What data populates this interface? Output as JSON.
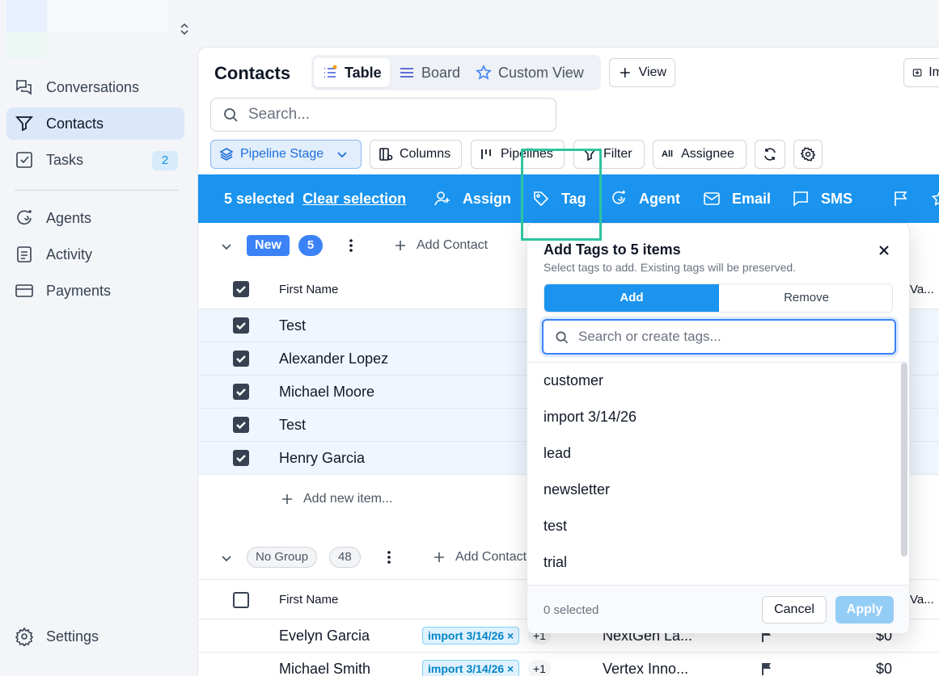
{
  "sidebar": {
    "items": [
      {
        "label": "Conversations",
        "icon": "chat-bubbles-icon"
      },
      {
        "label": "Contacts",
        "icon": "filter-funnel-icon"
      },
      {
        "label": "Tasks",
        "icon": "checkbox-icon",
        "badge": "2"
      },
      {
        "label": "Agents",
        "icon": "sparkle-agent-icon"
      },
      {
        "label": "Activity",
        "icon": "document-list-icon"
      },
      {
        "label": "Payments",
        "icon": "credit-card-icon"
      }
    ],
    "settings_label": "Settings"
  },
  "header": {
    "title": "Contacts",
    "tabs": [
      {
        "label": "Table",
        "active": true
      },
      {
        "label": "Board",
        "active": false
      },
      {
        "label": "Custom View",
        "active": false
      }
    ],
    "add_view_label": "View",
    "import_label": "Im"
  },
  "search": {
    "placeholder": "Search..."
  },
  "toolbar": {
    "pipeline_stage": "Pipeline Stage",
    "columns": "Columns",
    "pipelines": "Pipelines",
    "filter": "Filter",
    "assignee_prefix": "All",
    "assignee": "Assignee"
  },
  "selection_bar": {
    "count_text": "5 selected",
    "clear_label": "Clear selection",
    "actions": [
      "Assign",
      "Tag",
      "Agent",
      "Email",
      "SMS"
    ]
  },
  "groups": [
    {
      "name": "New",
      "count": "5",
      "add_contact_label": "Add Contact",
      "header_col": "First Name",
      "rows": [
        "Test",
        "Alexander Lopez",
        "Michael Moore",
        "Test",
        "Henry Garcia"
      ],
      "add_item_label": "Add new item..."
    },
    {
      "name": "No Group",
      "count": "48",
      "add_contact_label": "Add Contact",
      "header_col": "First Name",
      "rows": [
        {
          "name": "Evelyn Garcia",
          "tag": "import 3/14/26",
          "more": "+1",
          "company": "NextGen La...",
          "value": "$0"
        },
        {
          "name": "Michael Smith",
          "tag": "import 3/14/26",
          "more": "+1",
          "company": "Vertex Inno...",
          "value": "$0"
        }
      ]
    }
  ],
  "partial_header": "Va...",
  "tag_popover": {
    "title": "Add Tags to 5 items",
    "subtitle": "Select tags to add. Existing tags will be preserved.",
    "mode_add": "Add",
    "mode_remove": "Remove",
    "search_placeholder": "Search or create tags...",
    "options": [
      "customer",
      "import 3/14/26",
      "lead",
      "newsletter",
      "test",
      "trial"
    ],
    "selected_count": "0 selected",
    "cancel_label": "Cancel",
    "apply_label": "Apply"
  },
  "colors": {
    "accent": "#1a94ee",
    "highlight": "#2ec4a0",
    "group_new": "#3b82f6"
  }
}
